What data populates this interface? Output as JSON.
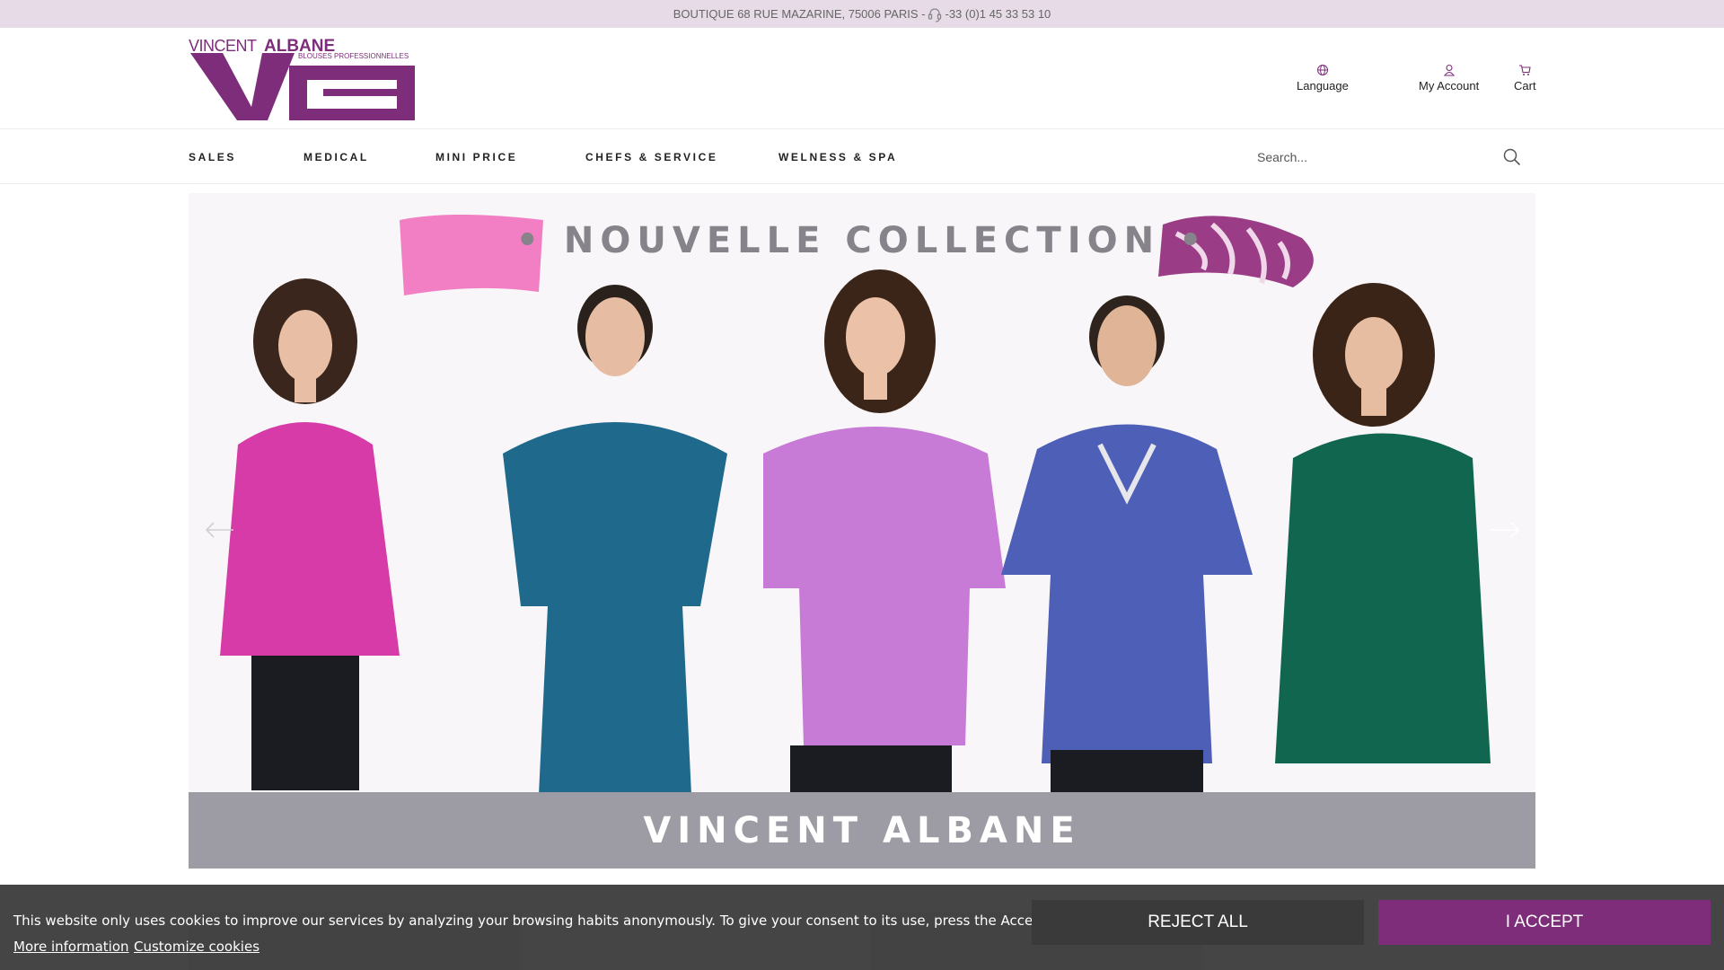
{
  "topbar": {
    "address": "BOUTIQUE 68 RUE MAZARINE, 75006 PARIS - ",
    "phone": "-33 (0)1 45 33 53 10",
    "phone_icon": "headset-icon"
  },
  "brand": {
    "name_light": "VINCENT",
    "name_bold": "ALBANE",
    "tagline": "BLOUSES PROFESSIONNELLES",
    "monogram": "Va",
    "color": "#7d2d7a"
  },
  "header": {
    "language_label": "Language",
    "account_label": "My Account",
    "cart_label": "Cart"
  },
  "nav": {
    "items": [
      {
        "label": "SALES"
      },
      {
        "label": "MEDICAL"
      },
      {
        "label": "MINI PRICE"
      },
      {
        "label": "CHEFS & SERVICE"
      },
      {
        "label": "WELNESS & SPA"
      }
    ],
    "search_placeholder": "Search..."
  },
  "banner": {
    "headline": "• NOUVELLE COLLECTION •",
    "footer": "VINCENT ALBANE",
    "models": [
      {
        "tunic_color": "#d63ba8"
      },
      {
        "tunic_color": "#1f6a8c"
      },
      {
        "tunic_color": "#c77ad6"
      },
      {
        "tunic_color": "#4d5fb6"
      },
      {
        "tunic_color": "#116650"
      }
    ]
  },
  "cookie": {
    "message": "This website only uses cookies to improve our services by analyzing your browsing habits anonymously. To give your consent to its use, press the Accept button.",
    "more_info": "More information",
    "customize": "Customize cookies",
    "reject": "REJECT ALL",
    "accept": "I ACCEPT"
  }
}
